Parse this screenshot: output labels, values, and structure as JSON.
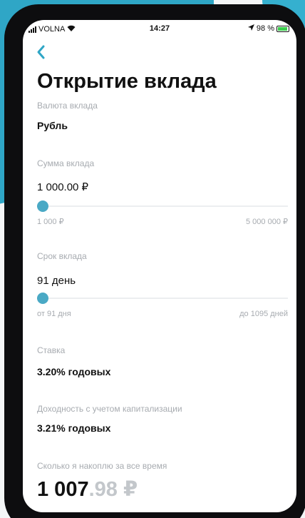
{
  "status_bar": {
    "carrier": "VOLNA",
    "time": "14:27",
    "battery": "98 %"
  },
  "header": {
    "title": "Открытие вклада"
  },
  "currency": {
    "label": "Валюта вклада",
    "value": "Рубль"
  },
  "amount": {
    "label": "Сумма вклада",
    "value": "1 000.00 ₽",
    "min_label": "1 000 ₽",
    "max_label": "5 000 000 ₽",
    "slider_fraction": 0.0
  },
  "term": {
    "label": "Срок вклада",
    "value": "91 день",
    "min_label": "от 91 дня",
    "max_label": "до 1095 дней",
    "slider_fraction": 0.0
  },
  "rate": {
    "label": "Ставка",
    "value": "3.20% годовых"
  },
  "yield": {
    "label": "Доходность с учетом капитализации",
    "value": "3.21% годовых"
  },
  "accumulated": {
    "label": "Сколько я накоплю за все время",
    "whole": "1 007",
    "fraction": ".98 ₽"
  },
  "colors": {
    "accent": "#4aa9c5",
    "label": "#a7abb0"
  }
}
